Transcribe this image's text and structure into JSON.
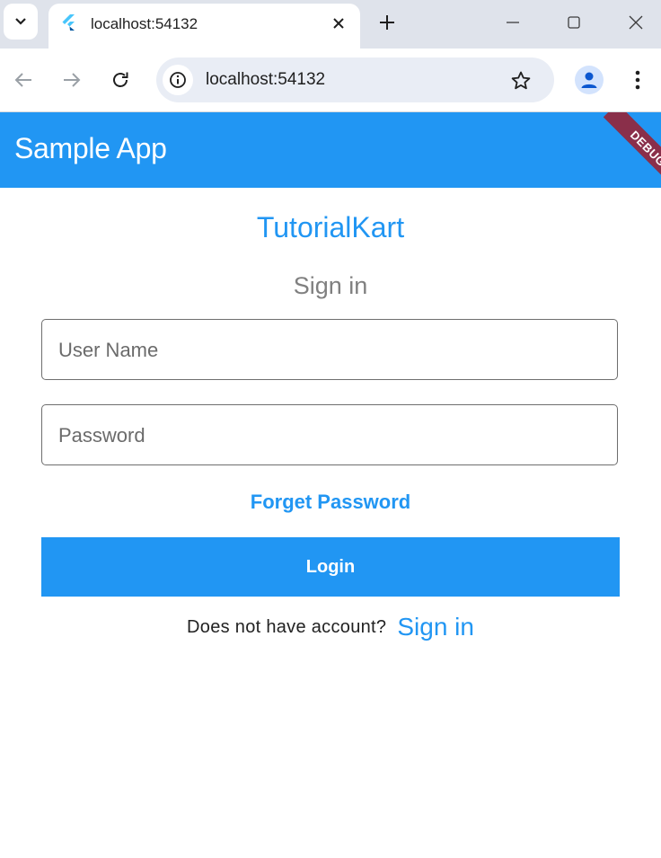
{
  "browser": {
    "tab_title": "localhost:54132",
    "url": "localhost:54132",
    "icons": {
      "tab_search": "chevron-down-icon",
      "favicon": "flutter-icon",
      "tab_close": "close-icon",
      "new_tab": "plus-icon",
      "minimize": "minimize-icon",
      "maximize": "maximize-icon",
      "close_window": "close-icon",
      "back": "arrow-left-icon",
      "forward": "arrow-right-icon",
      "reload": "reload-icon",
      "site_info": "info-icon",
      "bookmark": "star-icon",
      "profile": "person-icon",
      "menu": "more-vert-icon"
    }
  },
  "app": {
    "appbar_title": "Sample App",
    "debug_banner": "DEBUG",
    "brand": "TutorialKart",
    "subtitle": "Sign in",
    "username_placeholder": "User Name",
    "password_placeholder": "Password",
    "forget_password": "Forget Password",
    "login_label": "Login",
    "no_account_text": "Does not have account?",
    "signin_link": "Sign in",
    "colors": {
      "primary": "#2196f3",
      "debug": "#8a2f4a",
      "subtitle": "#808080"
    }
  }
}
